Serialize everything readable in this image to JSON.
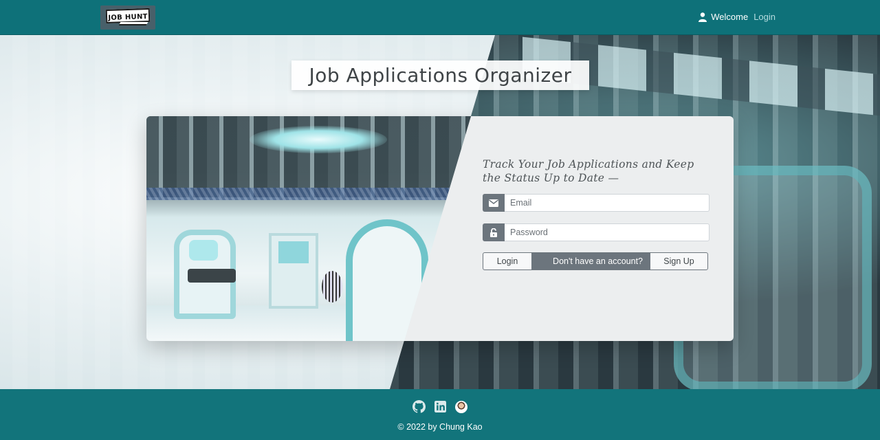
{
  "navbar": {
    "logo_text": "JOB HUNT",
    "welcome": "Welcome",
    "login_link": "Login",
    "user_icon": "user-icon"
  },
  "hero": {
    "title": "Job Applications Organizer"
  },
  "form": {
    "tagline": "Track Your Job Applications and Keep the Status Up to Date —",
    "email_placeholder": "Email",
    "password_placeholder": "Password",
    "email_icon": "envelope-icon",
    "password_icon": "unlock-icon",
    "login_button": "Login",
    "prompt": "Don't have an account?",
    "signup_button": "Sign Up"
  },
  "footer": {
    "icons": [
      "github-icon",
      "linkedin-icon",
      "avatar"
    ],
    "copyright": "© 2022 by Chung Kao"
  },
  "colors": {
    "primary": "#0e7179",
    "secondary": "#6c757d",
    "card": "#eceeef"
  }
}
